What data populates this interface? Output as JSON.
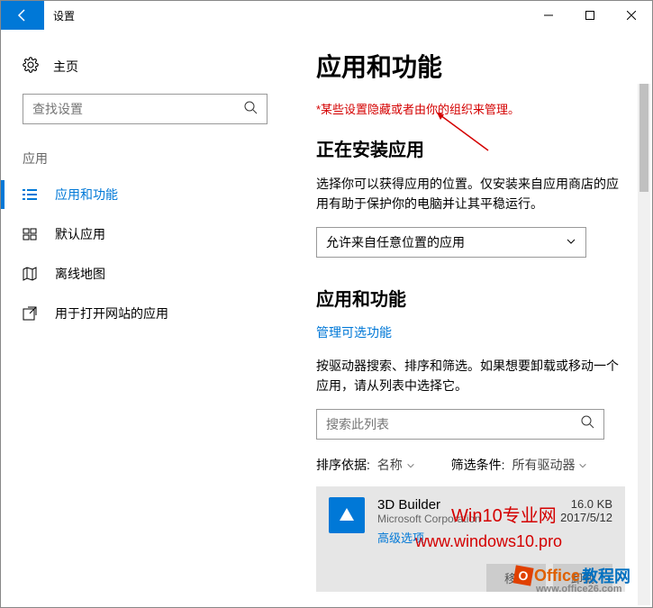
{
  "titlebar": {
    "title": "设置"
  },
  "sidebar": {
    "home": "主页",
    "search_placeholder": "查找设置",
    "category": "应用",
    "items": [
      {
        "label": "应用和功能"
      },
      {
        "label": "默认应用"
      },
      {
        "label": "离线地图"
      },
      {
        "label": "用于打开网站的应用"
      }
    ]
  },
  "main": {
    "heading": "应用和功能",
    "warning": "*某些设置隐藏或者由你的组织来管理。",
    "install_heading": "正在安装应用",
    "install_desc": "选择你可以获得应用的位置。仅安装来自应用商店的应用有助于保护你的电脑并让其平稳运行。",
    "dropdown_value": "允许来自任意位置的应用",
    "apps_heading": "应用和功能",
    "manage_link": "管理可选功能",
    "apps_desc": "按驱动器搜索、排序和筛选。如果想要卸载或移动一个应用，请从列表中选择它。",
    "search2_placeholder": "搜索此列表",
    "sort_label": "排序依据:",
    "sort_value": "名称",
    "filter_label": "筛选条件:",
    "filter_value": "所有驱动器",
    "app": {
      "name": "3D Builder",
      "publisher": "Microsoft Corporation",
      "size": "16.0 KB",
      "date": "2017/5/12",
      "advanced": "高级选项",
      "move": "移动",
      "uninstall": "卸载"
    }
  },
  "overlays": {
    "o1": "Win10专业网",
    "o2": "www.windows10.pro",
    "o3a": "Office",
    "o3b": "教程网",
    "o3c": "www.office26.com"
  }
}
